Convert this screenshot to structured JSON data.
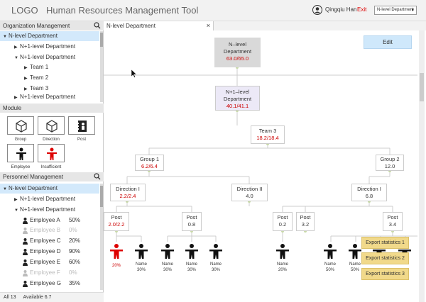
{
  "header": {
    "logo": "LOGO",
    "title": "Human Resources Management Tool",
    "user": "Qingqiu Han",
    "exit": "Exit",
    "dept_select": "N-level Department"
  },
  "org": {
    "title": "Organization Management",
    "items": [
      {
        "label": "N-level Department"
      },
      {
        "label": "N+1-level Department"
      },
      {
        "label": "N+1-level Department"
      },
      {
        "label": "Team 1"
      },
      {
        "label": "Team 2"
      },
      {
        "label": "Team 3"
      },
      {
        "label": "N+1-level Department"
      }
    ]
  },
  "module": {
    "title": "Module",
    "cards": [
      {
        "label": "Group",
        "icon": "cube-icon"
      },
      {
        "label": "Direction",
        "icon": "cube-icon"
      },
      {
        "label": "Post",
        "icon": "person-icon"
      },
      {
        "label": "Employee",
        "icon": "person-icon"
      },
      {
        "label": "Insufficient",
        "icon": "person-icon"
      }
    ]
  },
  "personnel": {
    "title": "Personnel Management",
    "items": [
      {
        "label": "N-level Department"
      },
      {
        "label": "N+1-level Department"
      },
      {
        "label": "N+1-level Department"
      }
    ],
    "employees": [
      {
        "name": "Employee A",
        "pct": "50%"
      },
      {
        "name": "Employee B",
        "pct": "0%"
      },
      {
        "name": "Employee C",
        "pct": "20%"
      },
      {
        "name": "Employee D",
        "pct": "90%"
      },
      {
        "name": "Employee E",
        "pct": "60%"
      },
      {
        "name": "Employee F",
        "pct": "0%"
      },
      {
        "name": "Employee G",
        "pct": "35%"
      }
    ]
  },
  "footer": {
    "all_label": "All",
    "all": "13",
    "avail_label": "Available",
    "avail": "6.7"
  },
  "tab": {
    "label": "N-level Department",
    "close": "×"
  },
  "edit": "Edit",
  "nodes": {
    "root": {
      "name": "N–level Department",
      "value": "63.0/65.0"
    },
    "n1": {
      "name": "N+1–level Department",
      "value": "40.1/41.1"
    },
    "team3": {
      "name": "Team 3",
      "value": "18.2/18.4"
    },
    "group1": {
      "name": "Group 1",
      "value": "6.2/6.4"
    },
    "group2": {
      "name": "Group 2",
      "value": "12.0"
    },
    "dir1a": {
      "name": "Direction I",
      "value": "2.2/2.4"
    },
    "dir2": {
      "name": "Direction II",
      "value": "4.0"
    },
    "dir1b": {
      "name": "Direction I",
      "value": "6.8"
    },
    "post1": {
      "name": "Post",
      "value": "2.0/2.2"
    },
    "post2": {
      "name": "Post",
      "value": "0.8"
    },
    "post3": {
      "name": "Post",
      "value": "0.2"
    },
    "post4": {
      "name": "Post",
      "value": "3.2"
    },
    "post5": {
      "name": "Post",
      "value": "3.4"
    }
  },
  "figures": [
    {
      "label": "",
      "pct": "20%",
      "red": true
    },
    {
      "label": "Name",
      "pct": "30%"
    },
    {
      "label": "Name",
      "pct": "30%"
    },
    {
      "label": "Name",
      "pct": "30%"
    },
    {
      "label": "Name",
      "pct": "30%"
    },
    {
      "label": "Name",
      "pct": "20%"
    },
    {
      "label": "Name",
      "pct": "50%"
    },
    {
      "label": "Name",
      "pct": "50%"
    }
  ],
  "exports": [
    "Export statistics 1",
    "Export statistics 2",
    "Export statistics 3"
  ],
  "colors": {
    "accent_red": "#cc0000",
    "selected": "#d3e9fb",
    "export": "#f1d98a",
    "edit": "#cfe8fb"
  }
}
